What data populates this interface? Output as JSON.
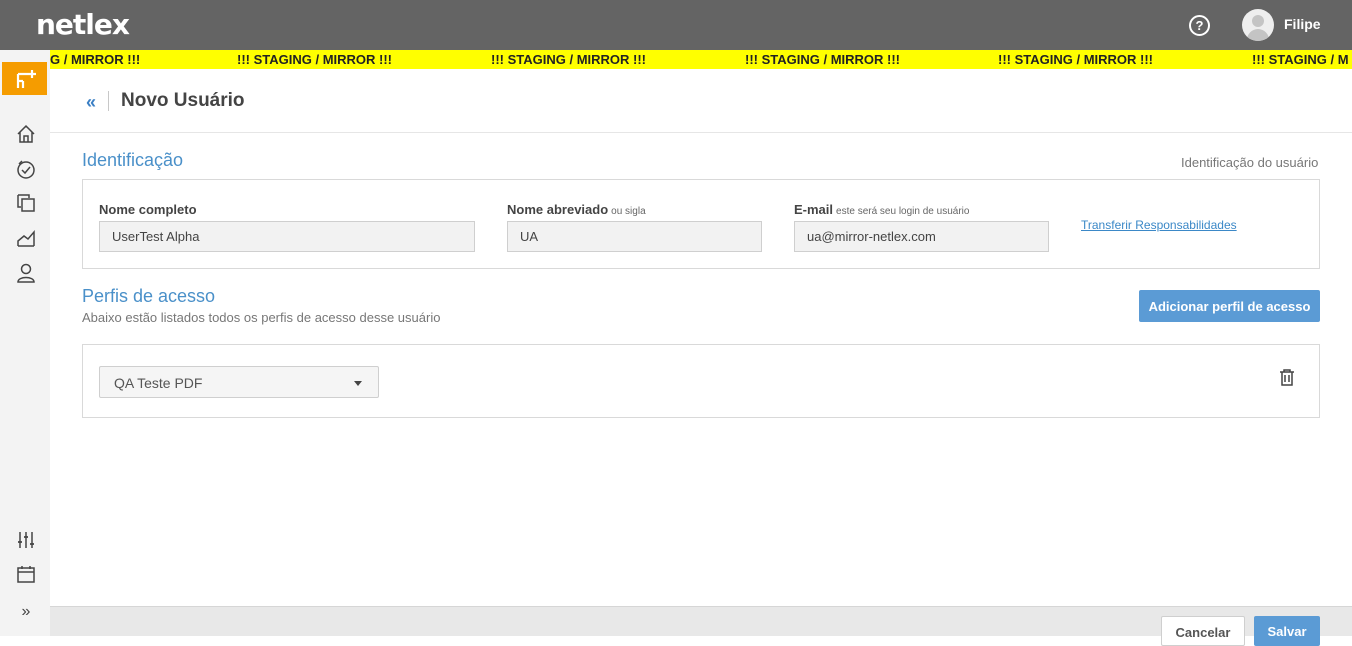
{
  "app": {
    "logo": "netlex"
  },
  "topbar": {
    "help_icon": "question-circle-icon",
    "user_name": "Filipe"
  },
  "banner": {
    "segment_first": "G / MIRROR !!!",
    "segment": "!!! STAGING / MIRROR !!!",
    "segment_last": "!!! STAGING / M",
    "color": "#ffff00"
  },
  "sidebar": {
    "new_icon": "new-item-icon",
    "icons": [
      "home-icon",
      "tasks-check-icon",
      "documents-icon",
      "chart-icon",
      "user-icon"
    ],
    "bottom_icons": [
      "settings-sliders-icon",
      "calendar-icon",
      "expand-icon"
    ],
    "expand_label": "»"
  },
  "header": {
    "back_label": "«",
    "title": "Novo Usuário"
  },
  "identificacao": {
    "title": "Identificação",
    "right_label": "Identificação do usuário",
    "nome_completo_label": "Nome completo",
    "nome_completo_value": "UserTest Alpha",
    "nome_abreviado_label": "Nome abreviado",
    "nome_abreviado_hint": "ou sigla",
    "nome_abreviado_value": "UA",
    "email_label": "E-mail",
    "email_hint": "este será seu login de usuário",
    "email_value": "ua@mirror-netlex.com",
    "transfer_link": "Transferir Responsabilidades"
  },
  "perfis": {
    "title": "Perfis de acesso",
    "subtitle": "Abaixo estão listados todos os perfis de acesso desse usuário",
    "add_button": "Adicionar perfil de acesso",
    "selected_profile": "QA Teste PDF",
    "delete_icon": "trash-icon"
  },
  "footer": {
    "cancel": "Cancelar",
    "save": "Salvar"
  },
  "colors": {
    "accent": "#5b9bd5",
    "brand_orange": "#f59c00",
    "topbar": "#646464",
    "section_title": "#4a90c9"
  }
}
